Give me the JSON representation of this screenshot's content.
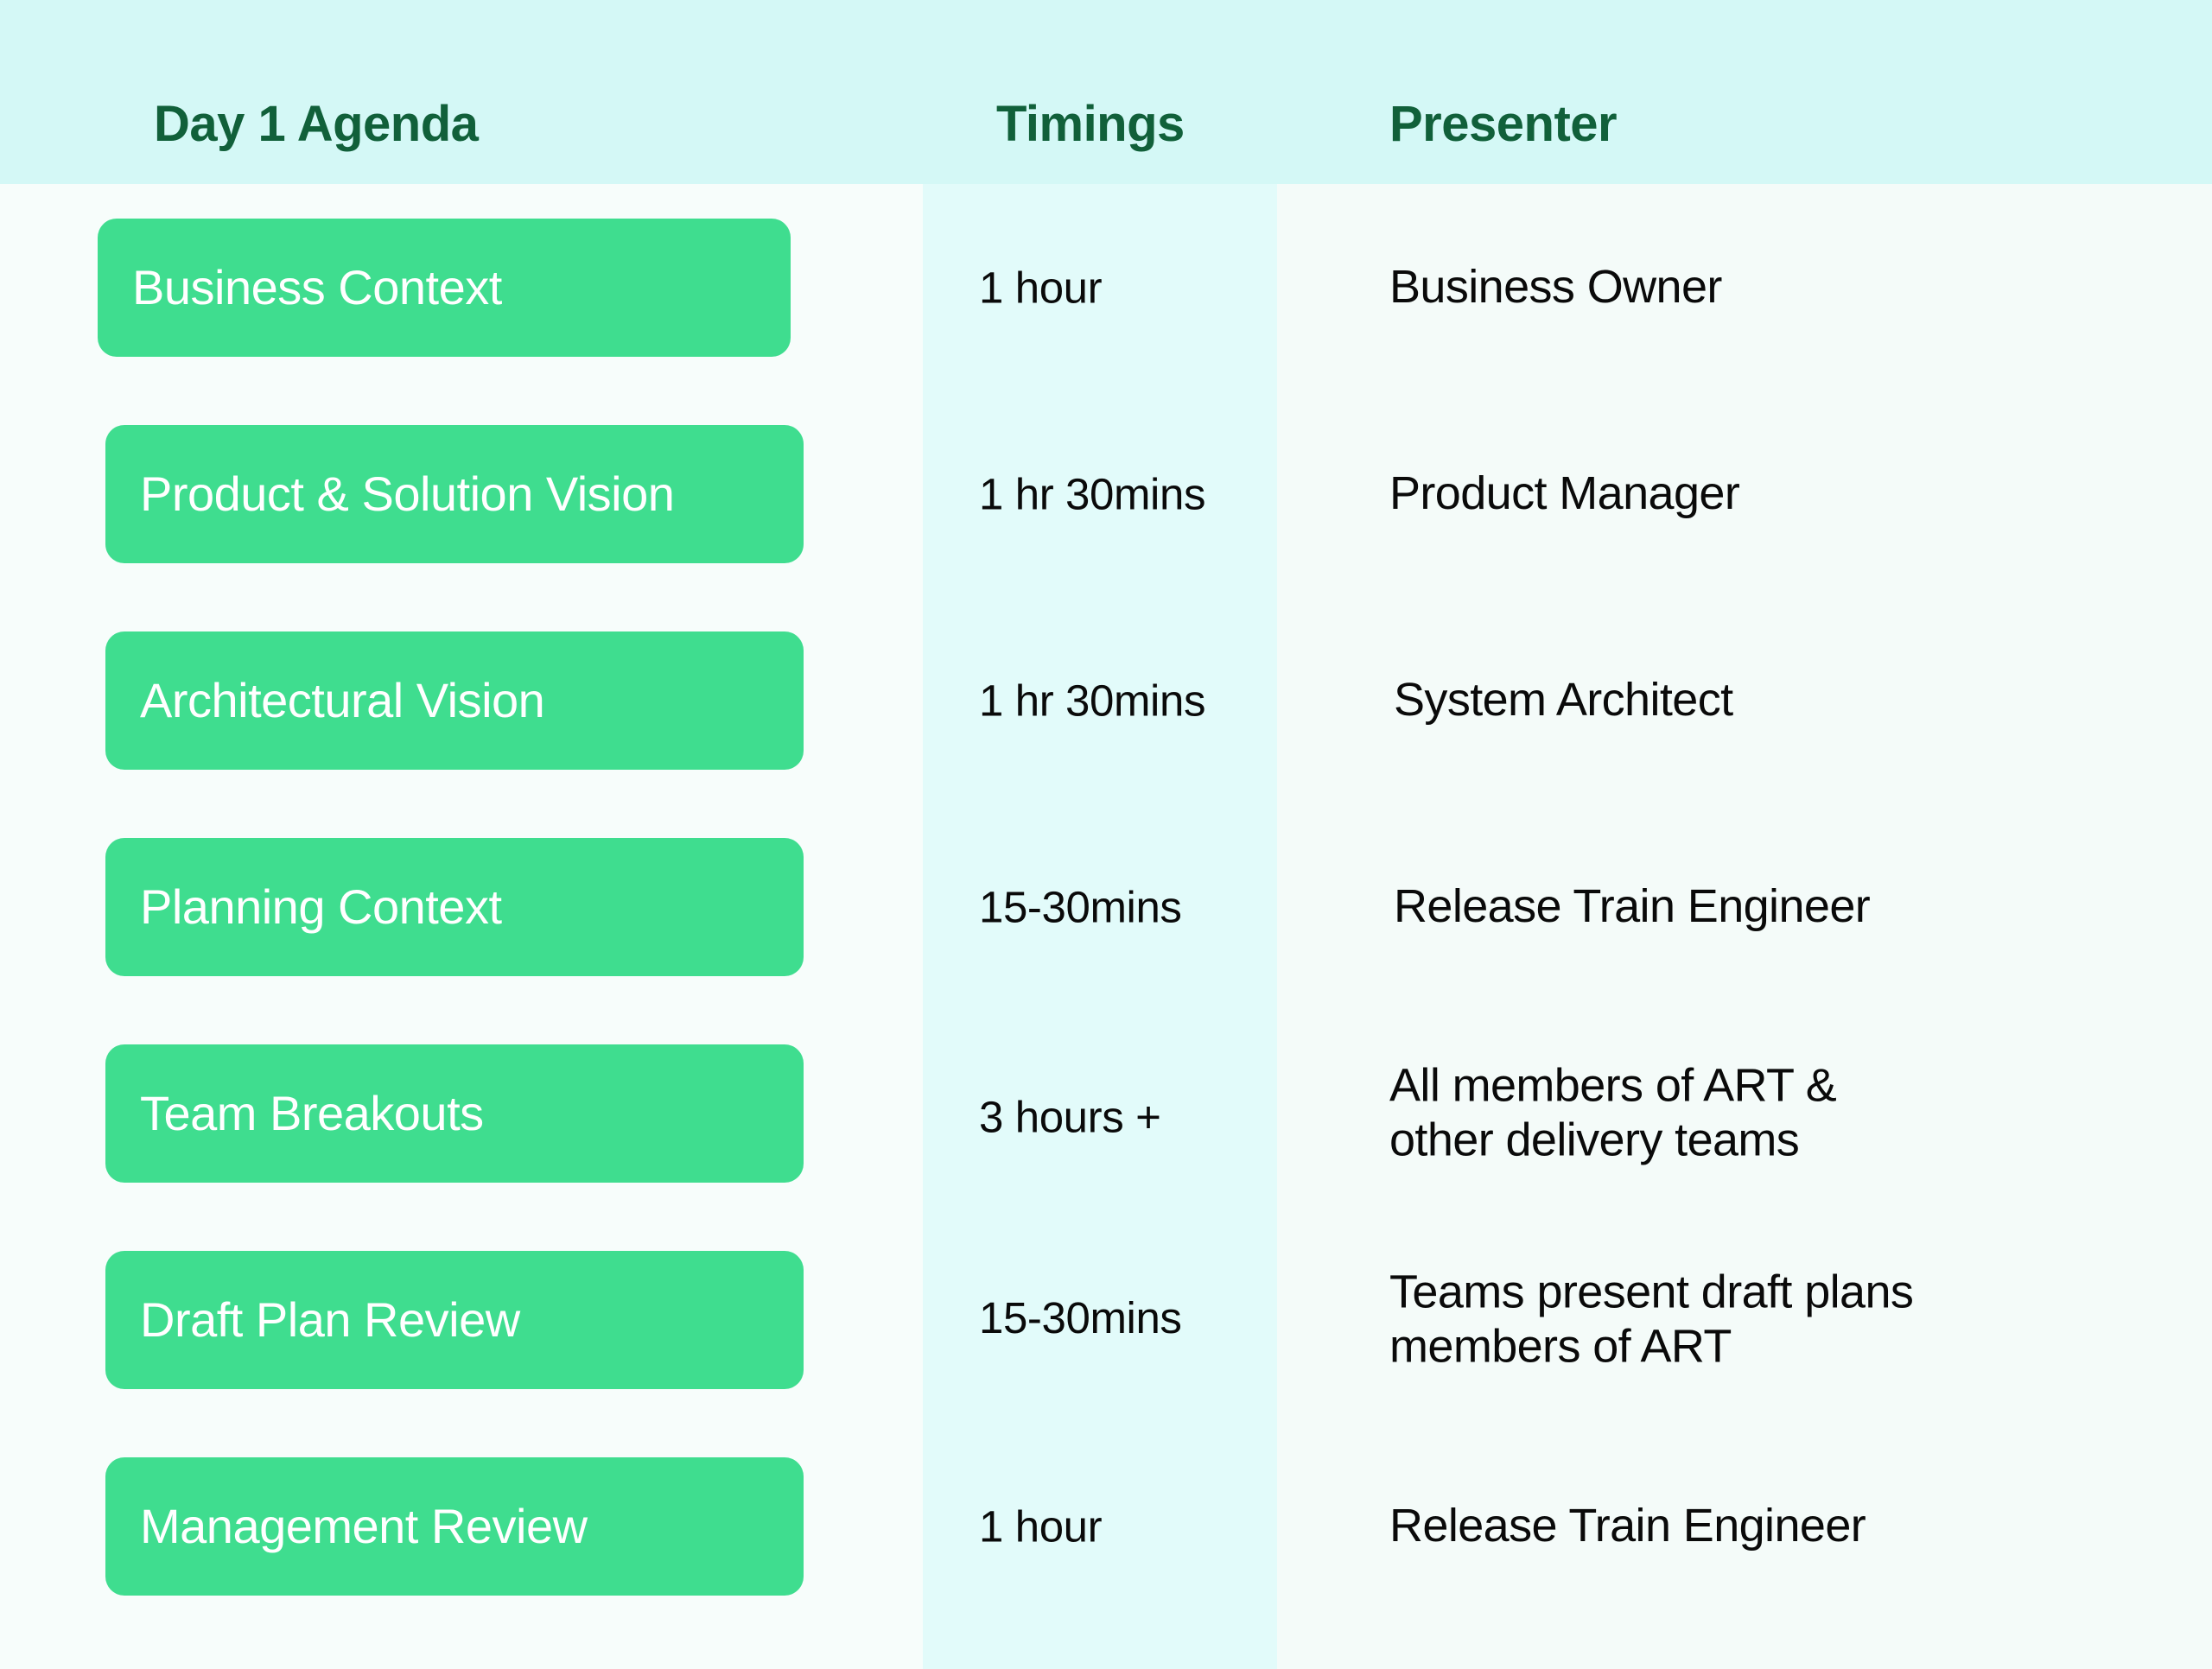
{
  "header": {
    "agenda_label": "Day 1 Agenda",
    "timings_label": "Timings",
    "presenter_label": "Presenter"
  },
  "colors": {
    "header_band": "#d4f8f6",
    "header_text": "#11603a",
    "pill": "#3fdd8f",
    "pill_text": "#ffffff",
    "timings_band": "#e2fbfa",
    "presenter_band": "#f4fbf9",
    "page_background": "#f7fdfb",
    "body_text": "#0a0a0a"
  },
  "rows": [
    {
      "agenda": "Business Context",
      "timing": "1 hour",
      "presenter_line1": "Business Owner",
      "presenter_line2": ""
    },
    {
      "agenda": "Product & Solution Vision",
      "timing": "1 hr 30mins",
      "presenter_line1": "Product Manager",
      "presenter_line2": ""
    },
    {
      "agenda": "Architectural Vision",
      "timing": "1 hr 30mins",
      "presenter_line1": "System Architect",
      "presenter_line2": ""
    },
    {
      "agenda": "Planning Context",
      "timing": "15-30mins",
      "presenter_line1": "Release Train Engineer",
      "presenter_line2": ""
    },
    {
      "agenda": "Team Breakouts",
      "timing": "3 hours +",
      "presenter_line1": "All members of ART &",
      "presenter_line2": "other delivery teams"
    },
    {
      "agenda": "Draft Plan Review",
      "timing": "15-30mins",
      "presenter_line1": "Teams present draft plans",
      "presenter_line2": "members of ART"
    },
    {
      "agenda": "Management Review",
      "timing": "1 hour",
      "presenter_line1": "Release Train Engineer",
      "presenter_line2": ""
    }
  ]
}
